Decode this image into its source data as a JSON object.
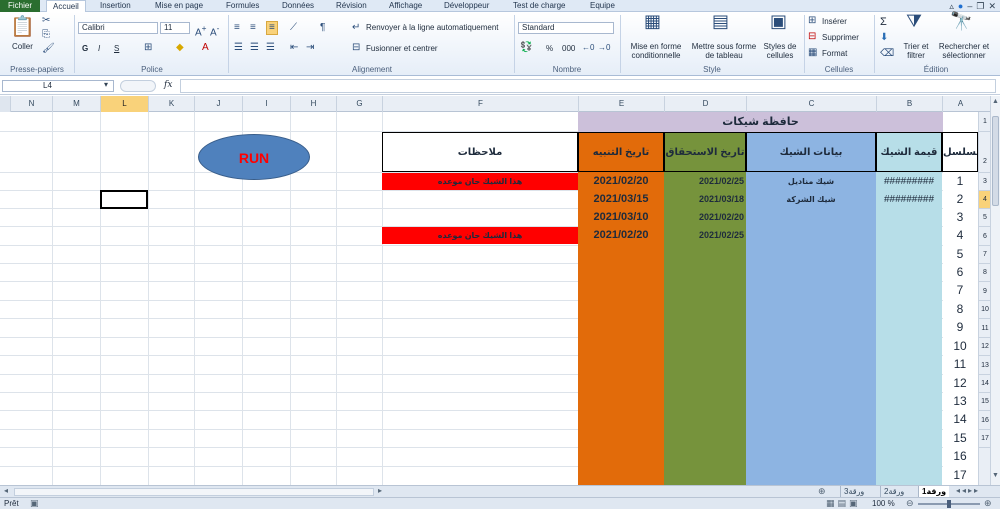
{
  "tabs": {
    "file": "Fichier",
    "items": [
      "Accueil",
      "Insertion",
      "Mise en page",
      "Formules",
      "Données",
      "Révision",
      "Affichage",
      "Développeur",
      "Test de charge",
      "Equipe"
    ]
  },
  "ribbon": {
    "clipboard": {
      "paste": "Coller",
      "label": "Presse-papiers"
    },
    "font": {
      "name": "Calibri",
      "size": "11",
      "bold": "G",
      "italic": "I",
      "underline": "S",
      "label": "Police"
    },
    "alignment": {
      "wrap": "Renvoyer à la ligne automatiquement",
      "merge": "Fusionner et centrer",
      "label": "Alignement"
    },
    "number": {
      "format": "Standard",
      "percent": "%",
      "thousands": "000",
      "label": "Nombre"
    },
    "styles": {
      "conditional": "Mise en forme conditionnelle",
      "table": "Mettre sous forme de tableau",
      "cell_styles": "Styles de cellules",
      "label": "Style"
    },
    "cells": {
      "insert": "Insérer",
      "delete": "Supprimer",
      "format": "Format",
      "label": "Cellules"
    },
    "editing": {
      "sum": "Σ",
      "sort": "Trier et filtrer",
      "find": "Rechercher et sélectionner",
      "label": "Édition"
    }
  },
  "formula_bar": {
    "name_box": "L4",
    "fx": "fx",
    "value": ""
  },
  "columns": [
    "N",
    "M",
    "L",
    "K",
    "J",
    "I",
    "H",
    "G",
    "F",
    "E",
    "D",
    "C",
    "B",
    "A"
  ],
  "selected_column": "L",
  "rows": [
    "1",
    "2",
    "3",
    "4",
    "5",
    "6",
    "7",
    "8",
    "9",
    "10",
    "11",
    "12",
    "13",
    "14",
    "15",
    "16",
    "17"
  ],
  "selected_row": "4",
  "sheet": {
    "title": "حافظة شيكات",
    "run_button": "RUN",
    "headers": {
      "serial": "مسلسل",
      "amount": "قيمة الشيك",
      "details": "بيانات الشيك",
      "due": "تاريخ الاستحقاق",
      "alert": "تاريخ التنبيه",
      "notes": "ملاحظات"
    },
    "serials": [
      "1",
      "2",
      "3",
      "4",
      "5",
      "6",
      "7",
      "8",
      "9",
      "10",
      "11",
      "12",
      "13",
      "14",
      "15",
      "16",
      "17"
    ],
    "records": [
      {
        "amount": "#########",
        "details": "شيك  مناديل",
        "due": "2021/02/25",
        "alert": "2021/02/20",
        "note": "هذا الشيك حان موعده"
      },
      {
        "amount": "#########",
        "details": "شيك الشركة",
        "due": "2021/03/18",
        "alert": "2021/03/15",
        "note": ""
      },
      {
        "amount": "",
        "details": "",
        "due": "2021/02/20",
        "alert": "2021/03/10",
        "note": ""
      },
      {
        "amount": "",
        "details": "",
        "due": "2021/02/25",
        "alert": "2021/02/20",
        "note": "هذا الشيك حان موعده"
      }
    ],
    "colors": {
      "title_bg": "#ccc0da",
      "serial_bg": "#ffffff",
      "amount_bg": "#b7dee8",
      "details_bg": "#8db4e2",
      "due_bg": "#76933c",
      "alert_bg": "#e26b0a",
      "note_bg": "#ff0000",
      "run_bg": "#4f81bd",
      "run_text": "#ff0000"
    }
  },
  "sheet_tabs": [
    "ورقة1",
    "ورقة2",
    "ورقة3"
  ],
  "active_sheet": "ورقة1",
  "status": {
    "ready": "Prêt",
    "zoom": "100 %"
  }
}
